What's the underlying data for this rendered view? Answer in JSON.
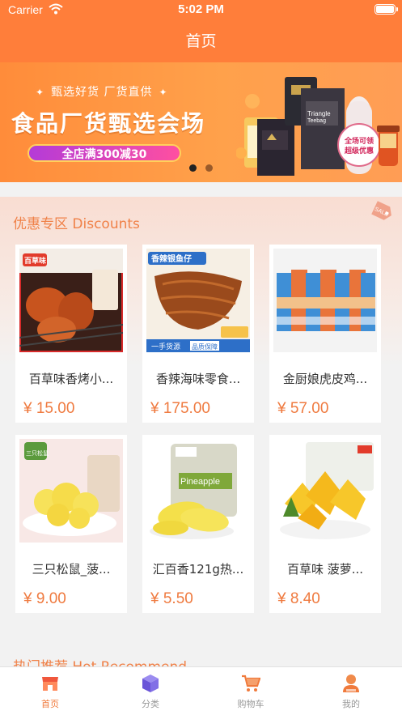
{
  "status_bar": {
    "carrier": "Carrier",
    "time": "5:02 PM"
  },
  "nav": {
    "title": "首页"
  },
  "banner": {
    "subtitle": "甄选好货 厂货直供",
    "title": "食品厂货甄选会场",
    "promo": "全店满300减30",
    "slides_total": 2,
    "active_slide": 1
  },
  "discounts": {
    "title": "优惠专区 Discounts",
    "items": [
      {
        "name": "百草味香烤小...",
        "price": "¥ 15.00"
      },
      {
        "name": "香辣海味零食...",
        "price": "¥ 175.00"
      },
      {
        "name": "金厨娘虎皮鸡...",
        "price": "¥ 57.00"
      },
      {
        "name": "三只松鼠_菠...",
        "price": "¥ 9.00"
      },
      {
        "name": "汇百香121g热...",
        "price": "¥ 5.50"
      },
      {
        "name": "百草味 菠萝...",
        "price": "¥ 8.40"
      }
    ]
  },
  "hot": {
    "title": "热门推荐 Hot Recommend"
  },
  "tabbar": {
    "items": [
      {
        "label": "首页",
        "icon": "shop-icon",
        "active": true
      },
      {
        "label": "分类",
        "icon": "cube-icon",
        "active": false
      },
      {
        "label": "购物车",
        "icon": "cart-icon",
        "active": false
      },
      {
        "label": "我的",
        "icon": "user-icon",
        "active": false
      }
    ]
  },
  "colors": {
    "primary": "#ff7e3a",
    "price": "#ef7a3f",
    "section_title": "#f08148",
    "tab_active": "#f07a3c"
  }
}
